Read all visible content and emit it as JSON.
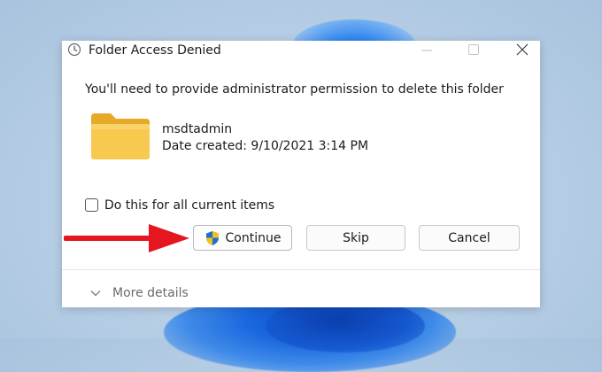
{
  "dialog": {
    "title": "Folder Access Denied",
    "message": "You'll need to provide administrator permission to delete this folder",
    "file": {
      "name": "msdtadmin",
      "date_created": "Date created: 9/10/2021 3:14 PM"
    },
    "checkbox": {
      "label": "Do this for all current items",
      "checked": false
    },
    "buttons": {
      "continue": "Continue",
      "skip": "Skip",
      "cancel": "Cancel"
    },
    "details_label": "More details"
  },
  "colors": {
    "arrow": "#e5161f",
    "folder": "#f6c247",
    "shield_blue": "#1f6fd1",
    "shield_yellow": "#f3c21a"
  },
  "icons": [
    "clock-icon",
    "minimize-icon",
    "maximize-icon",
    "close-icon",
    "folder-icon",
    "uac-shield-icon",
    "chevron-down-icon",
    "red-arrow-icon"
  ]
}
